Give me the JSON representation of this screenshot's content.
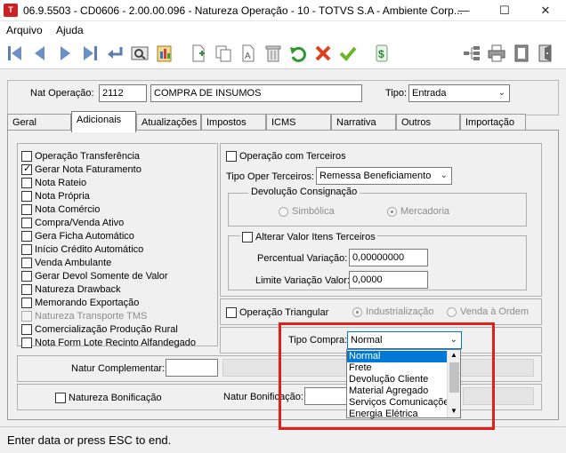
{
  "window": {
    "title": "06.9.5503 - CD0606 - 2.00.00.096 - Natureza Operação - 10 - TOTVS S.A - Ambiente Corp...",
    "app_icon": "totvs-logo",
    "minimize": "—",
    "maximize": "☐",
    "close": "✕"
  },
  "menu": {
    "items": [
      "Arquivo",
      "Ajuda"
    ]
  },
  "toolbar": {
    "icons": [
      "first-record-icon",
      "previous-record-icon",
      "next-record-icon",
      "last-record-icon",
      "return-icon",
      "view-icon",
      "report-icon",
      "new-document-icon",
      "copy-icon",
      "edit-text-icon",
      "delete-icon",
      "undo-icon",
      "cancel-icon",
      "confirm-icon",
      "currency-icon",
      "tree-icon",
      "print-icon",
      "manual-icon",
      "exit-icon"
    ]
  },
  "header": {
    "nat_label": "Nat Operação:",
    "nat_code": "2112",
    "nat_desc": "COMPRA DE INSUMOS",
    "tipo_label": "Tipo:",
    "tipo_value": "Entrada"
  },
  "tabs": [
    "Geral",
    "Adicionais",
    "Atualizações",
    "Impostos",
    "ICMS",
    "Narrativa",
    "Outros",
    "Importação"
  ],
  "active_tab": "Adicionais",
  "options": [
    {
      "label": "Operação Transferência",
      "checked": false,
      "disabled": false
    },
    {
      "label": "Gerar Nota Faturamento",
      "checked": true,
      "disabled": false
    },
    {
      "label": "Nota Rateio",
      "checked": false,
      "disabled": false
    },
    {
      "label": "Nota Própria",
      "checked": false,
      "disabled": false
    },
    {
      "label": "Nota Comércio",
      "checked": false,
      "disabled": false
    },
    {
      "label": "Compra/Venda Ativo",
      "checked": false,
      "disabled": false
    },
    {
      "label": "Gera Ficha Automático",
      "checked": false,
      "disabled": false
    },
    {
      "label": "Início Crédito Automático",
      "checked": false,
      "disabled": false
    },
    {
      "label": "Venda Ambulante",
      "checked": false,
      "disabled": false
    },
    {
      "label": "Gerar Devol Somente de Valor",
      "checked": false,
      "disabled": false
    },
    {
      "label": "Natureza Drawback",
      "checked": false,
      "disabled": false
    },
    {
      "label": "Memorando Exportação",
      "checked": false,
      "disabled": false
    },
    {
      "label": "Natureza Transporte TMS",
      "checked": false,
      "disabled": true
    },
    {
      "label": "Comercialização Produção Rural",
      "checked": false,
      "disabled": false
    },
    {
      "label": "Nota Form Lote Recinto Alfandegado",
      "checked": false,
      "disabled": false
    }
  ],
  "terceiros": {
    "op_label": "Operação com Terceiros",
    "tipo_label": "Tipo Oper Terceiros:",
    "tipo_value": "Remessa Beneficiamento",
    "devolucao_legend": "Devolução Consignação",
    "radio_simbolica": "Simbólica",
    "radio_mercadoria": "Mercadoria",
    "alterar_label": "Alterar Valor Itens Terceiros",
    "percentual_label": "Percentual Variação:",
    "percentual_value": "0,00000000",
    "limite_label": "Limite Variação Valor:",
    "limite_value": "0,0000"
  },
  "triangular": {
    "label": "Operação Triangular",
    "radio_industrializacao": "Industrialização",
    "radio_venda": "Venda à Ordem"
  },
  "compra": {
    "label": "Tipo Compra:",
    "value": "Normal",
    "options": [
      "Normal",
      "Frete",
      "Devolução Cliente",
      "Material Agregado",
      "Serviços Comunicações",
      "Energia Elétrica"
    ]
  },
  "natur_complementar_label": "Natur Complementar:",
  "natur_complementar_value": "",
  "bonificacao": {
    "checkbox_label": "Natureza Bonificação",
    "natur_label": "Natur Bonificação:",
    "natur_value": ""
  },
  "status": "Enter data or press ESC to end."
}
